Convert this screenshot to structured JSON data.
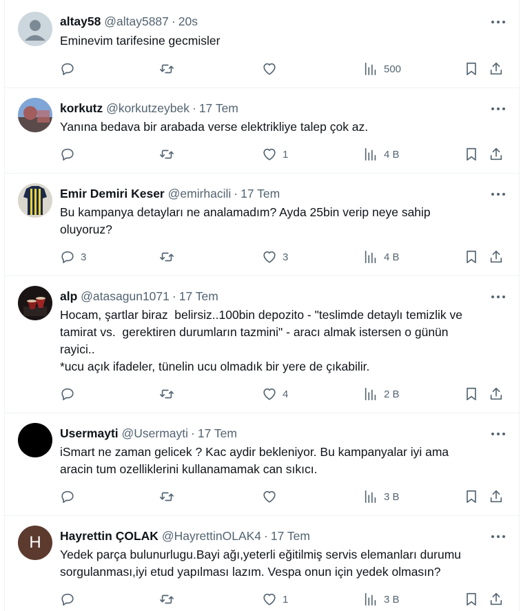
{
  "tweets": [
    {
      "name": "altay58",
      "handle": "@altay5887",
      "time": "20s",
      "text": "Eminevim tarifesine gecmisler",
      "replies": "",
      "retweets": "",
      "likes": "",
      "views": "500",
      "avatar": "default"
    },
    {
      "name": "korkutz",
      "handle": "@korkutzeybek",
      "time": "17 Tem",
      "text": "Yanına bedava bir arabada verse elektrikliye talep çok az.",
      "replies": "",
      "retweets": "",
      "likes": "1",
      "views": "4 B",
      "avatar": "photo-sky"
    },
    {
      "name": "Emir Demiri Keser",
      "handle": "@emirhacili",
      "time": "17 Tem",
      "text": "Bu kampanya detayları ne analamadım? Ayda 25bin verip neye sahip\noluyoruz?",
      "replies": "3",
      "retweets": "",
      "likes": "3",
      "views": "4 B",
      "avatar": "photo-jersey"
    },
    {
      "name": "alp",
      "handle": "@atasagun1071",
      "time": "17 Tem",
      "text": "Hocam, şartlar biraz  belirsiz..100bin depozito - \"teslimde detaylı temizlik ve\ntamirat vs.  gerektiren durumların tazmini\" - aracı almak istersen o günün\nrayici..\n*ucu açık ifadeler, tünelin ucu olmadık bir yere de çıkabilir.",
      "replies": "",
      "retweets": "",
      "likes": "4",
      "views": "2 B",
      "avatar": "photo-dark"
    },
    {
      "name": "Usermayti",
      "handle": "@Usermayti",
      "time": "17 Tem",
      "text": "iSmart ne zaman gelicek ? Kac aydir bekleniyor. Bu kampanyalar iyi ama\naracin tum ozelliklerini kullanamamak can sıkıcı.",
      "replies": "",
      "retweets": "",
      "likes": "",
      "views": "3 B",
      "avatar": "black"
    },
    {
      "name": "Hayrettin ÇOLAK",
      "handle": "@HayrettinOLAK4",
      "time": "17 Tem",
      "text": "Yedek parça bulunurlugu.Bayi ağı,yeterli eğitilmiş servis elemanları durumu\nsorgulanması,iyi etud yapılması lazım. Vespa onun için yedek olmasın?",
      "replies": "",
      "retweets": "",
      "likes": "1",
      "views": "3 B",
      "avatar": "letter",
      "avatar_letter": "H"
    }
  ],
  "colors": {
    "text": "#0f1419",
    "secondary": "#536471",
    "border": "#eff3f4",
    "letter_avatar": "#5c3a2e"
  }
}
